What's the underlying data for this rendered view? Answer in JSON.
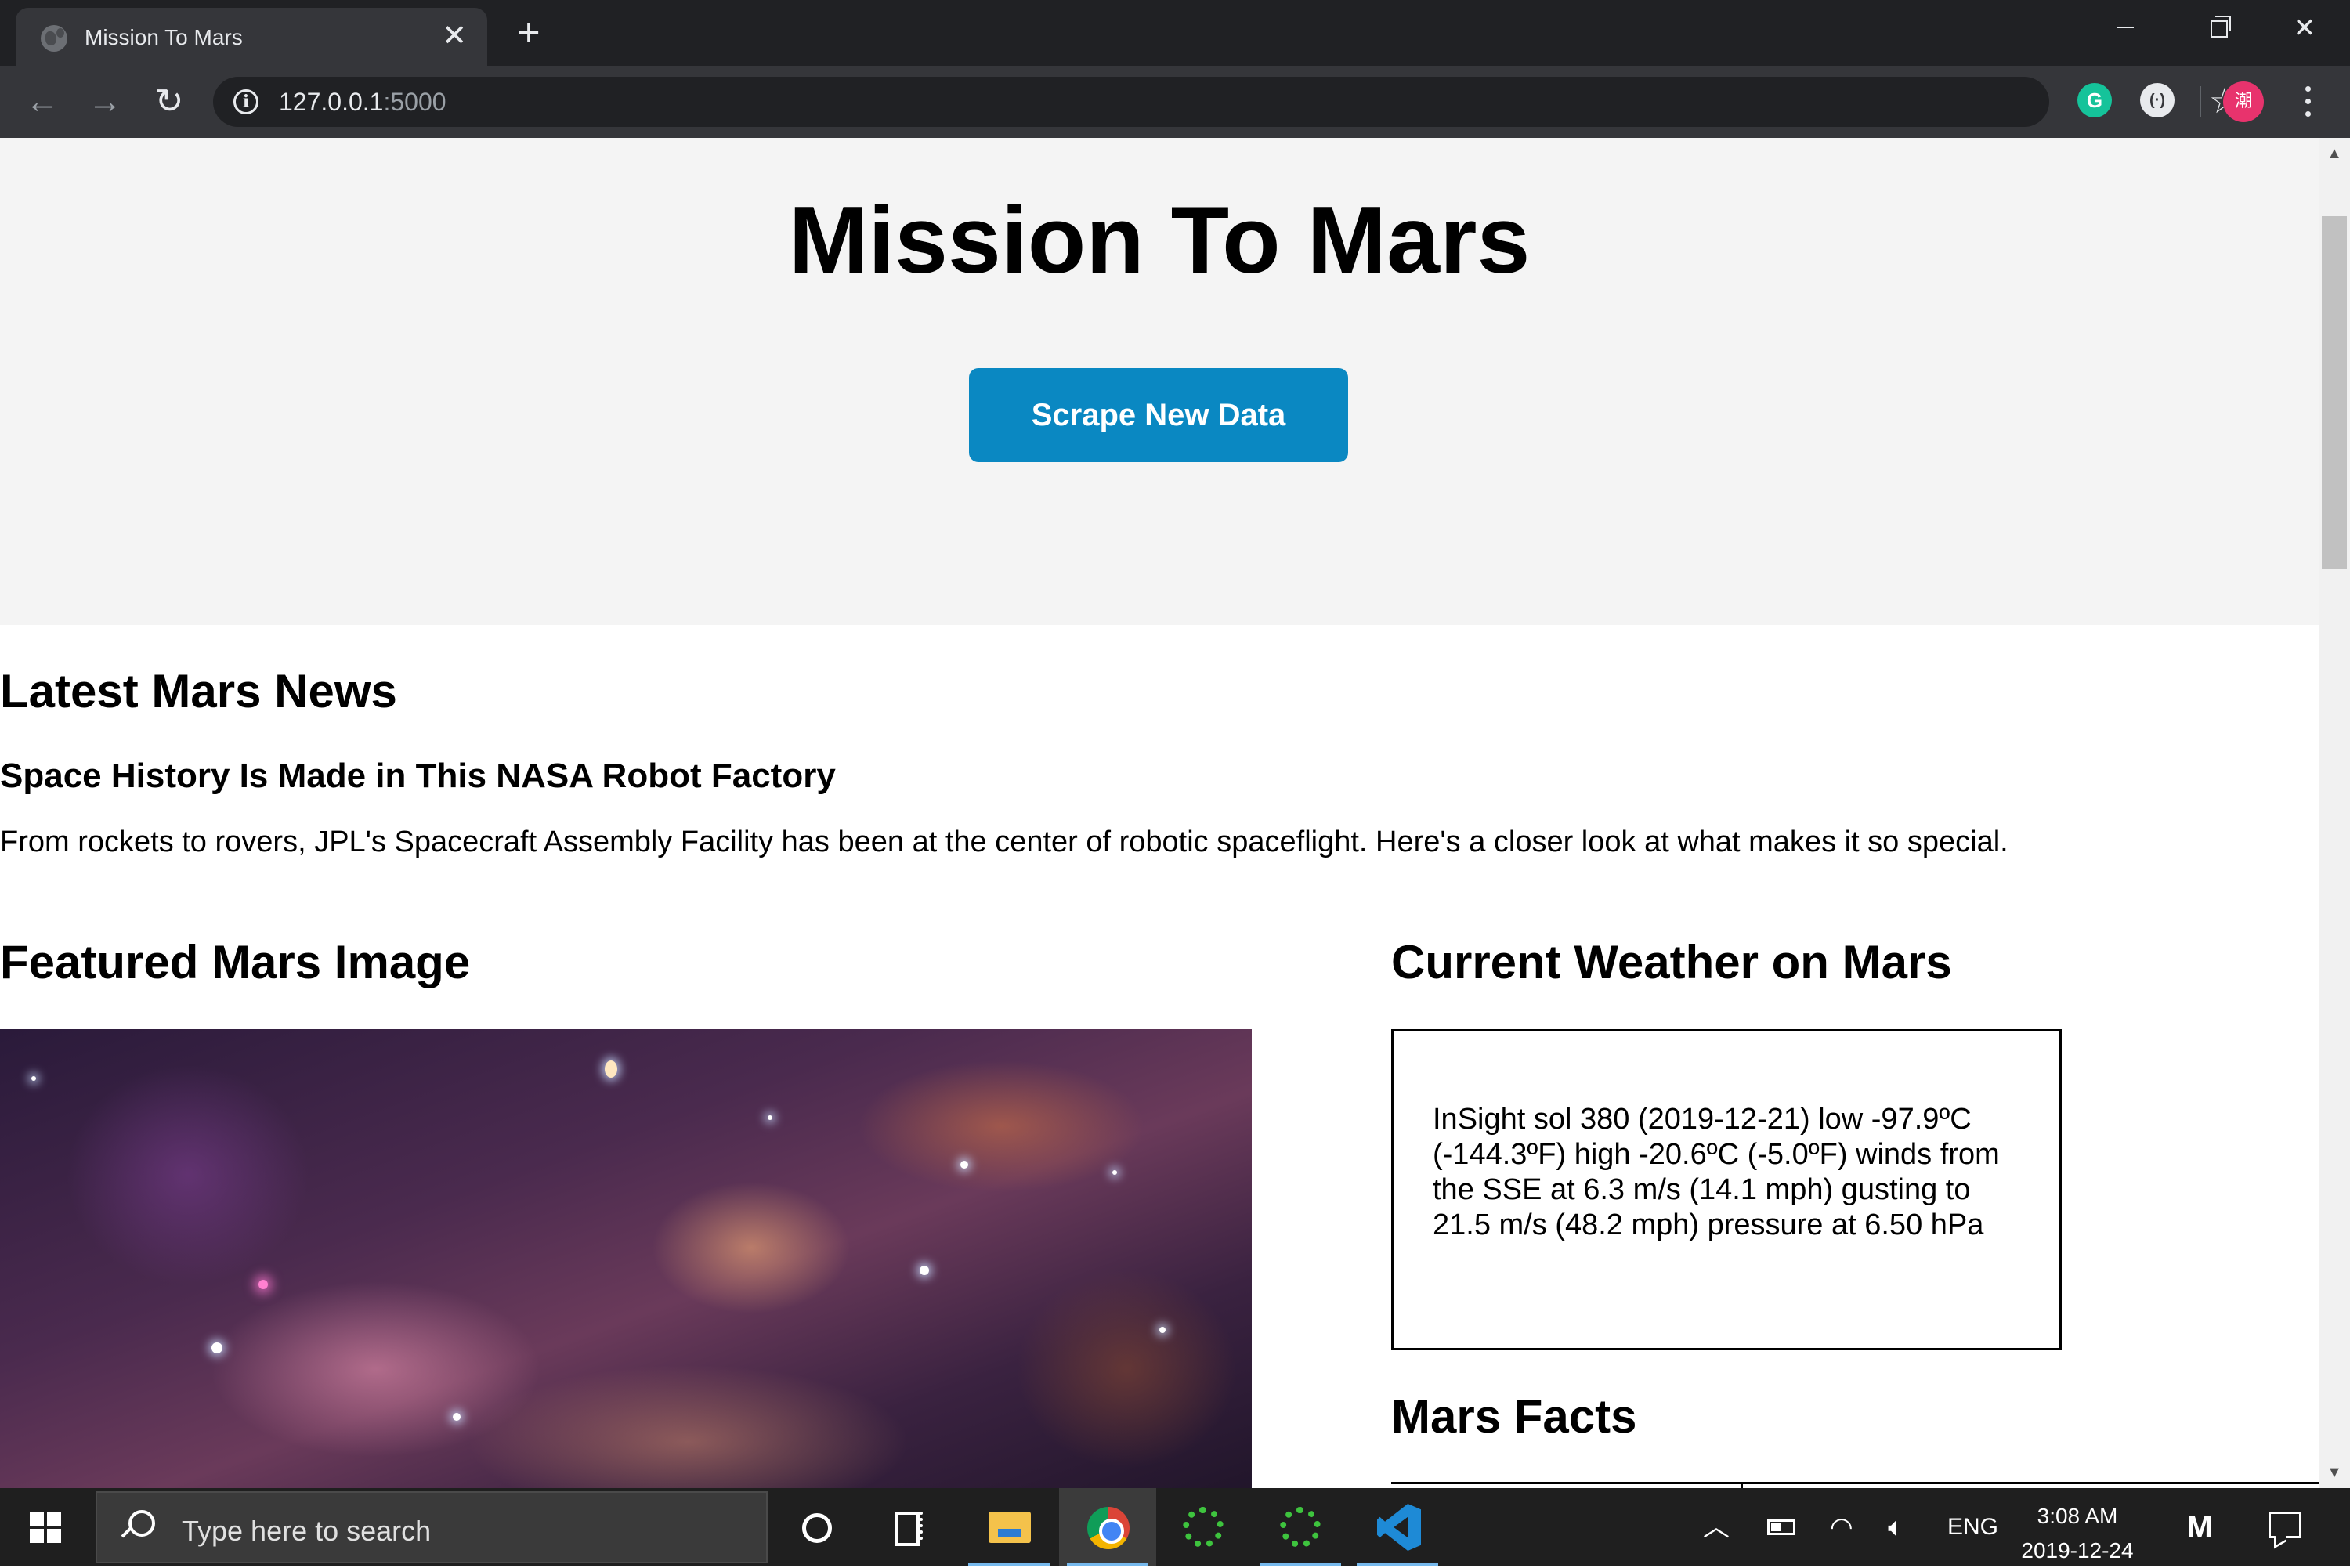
{
  "browser": {
    "tab_title": "Mission To Mars",
    "tab_close": "✕",
    "new_tab": "+",
    "url_host": "127.0.0.1",
    "url_port": ":5000",
    "avatar_text": "潮",
    "ext_grammarly": "G",
    "ext_second": "(·)"
  },
  "page": {
    "title": "Mission To Mars",
    "scrape_button": "Scrape New Data",
    "news_heading": "Latest Mars News",
    "news_title": "Space History Is Made in This NASA Robot Factory",
    "news_paragraph": "From rockets to rovers, JPL's Spacecraft Assembly Facility has been at the center of robotic spaceflight. Here's a closer look at what makes it so special.",
    "featured_heading": "Featured Mars Image",
    "weather_heading": "Current Weather on Mars",
    "weather_text": "InSight sol 380 (2019-12-21) low -97.9ºC (-144.3ºF) high -20.6ºC (-5.0ºF) winds from the SSE at 6.3 m/s (14.1 mph) gusting to 21.5 m/s (48.2 mph) pressure at 6.50 hPa",
    "facts_heading": "Mars Facts"
  },
  "taskbar": {
    "search_placeholder": "Type here to search",
    "language": "ENG",
    "time": "3:08 AM",
    "date": "2019-12-24"
  },
  "icons": {
    "back": "arrow-left-icon",
    "forward": "arrow-right-icon",
    "reload": "reload-icon",
    "info": "info-icon",
    "star": "star-icon",
    "menu": "kebab-menu-icon"
  },
  "colors": {
    "accent_button": "#0a88c2",
    "jumbotron_bg": "#f4f4f4",
    "chrome_dark": "#202124"
  }
}
